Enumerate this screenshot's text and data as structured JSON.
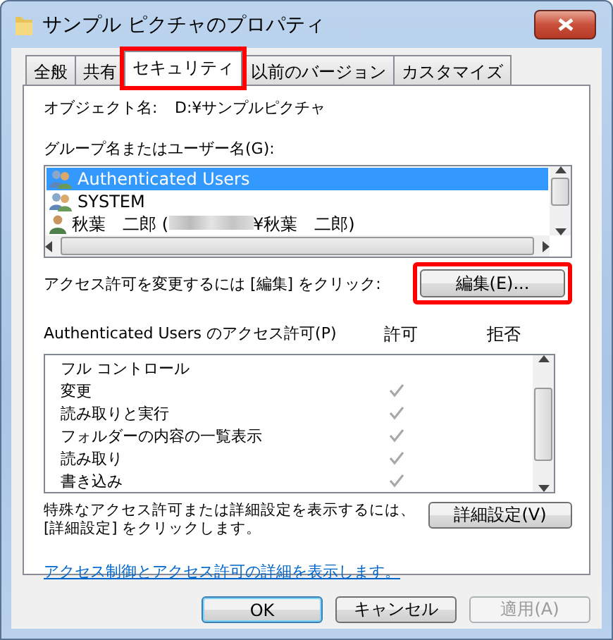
{
  "window": {
    "title": "サンプル ピクチャのプロパティ"
  },
  "tabs": [
    {
      "label": "全般",
      "selected": false,
      "highlighted": false
    },
    {
      "label": "共有",
      "selected": false,
      "highlighted": false
    },
    {
      "label": "セキュリティ",
      "selected": true,
      "highlighted": true
    },
    {
      "label": "以前のバージョン",
      "selected": false,
      "highlighted": false
    },
    {
      "label": "カスタマイズ",
      "selected": false,
      "highlighted": false
    }
  ],
  "object_name": {
    "label": "オブジェクト名:",
    "value": "D:¥サンプルピクチャ"
  },
  "users": {
    "label": "グループ名またはユーザー名(G):",
    "items": [
      {
        "kind": "group",
        "name": "Authenticated Users",
        "selected": true
      },
      {
        "kind": "group",
        "name": "SYSTEM",
        "selected": false
      },
      {
        "kind": "user",
        "name": "秋葉　二郎 (",
        "redacted": true,
        "suffix": "¥秋葉　二郎)",
        "selected": false
      }
    ]
  },
  "edit": {
    "text": "アクセス許可を変更するには [編集] をクリック:",
    "button": "編集(E)...",
    "highlighted": true
  },
  "permissions": {
    "title": "Authenticated Users のアクセス許可(P)",
    "allow_header": "許可",
    "deny_header": "拒否",
    "rows": [
      {
        "name": "フル コントロール",
        "allow": false,
        "deny": false
      },
      {
        "name": "変更",
        "allow": true,
        "deny": false
      },
      {
        "name": "読み取りと実行",
        "allow": true,
        "deny": false
      },
      {
        "name": "フォルダーの内容の一覧表示",
        "allow": true,
        "deny": false
      },
      {
        "name": "読み取り",
        "allow": true,
        "deny": false
      },
      {
        "name": "書き込み",
        "allow": true,
        "deny": false
      }
    ]
  },
  "advanced": {
    "text": "特殊なアクセス許可または詳細設定を表示するには、[詳細設定] をクリックします。",
    "button": "詳細設定(V)"
  },
  "link": "アクセス制御とアクセス許可の詳細を表示します。",
  "buttons": [
    {
      "label": "OK",
      "disabled": false,
      "default": true
    },
    {
      "label": "キャンセル",
      "disabled": false,
      "default": false
    },
    {
      "label": "適用(A)",
      "disabled": true,
      "default": false
    }
  ]
}
